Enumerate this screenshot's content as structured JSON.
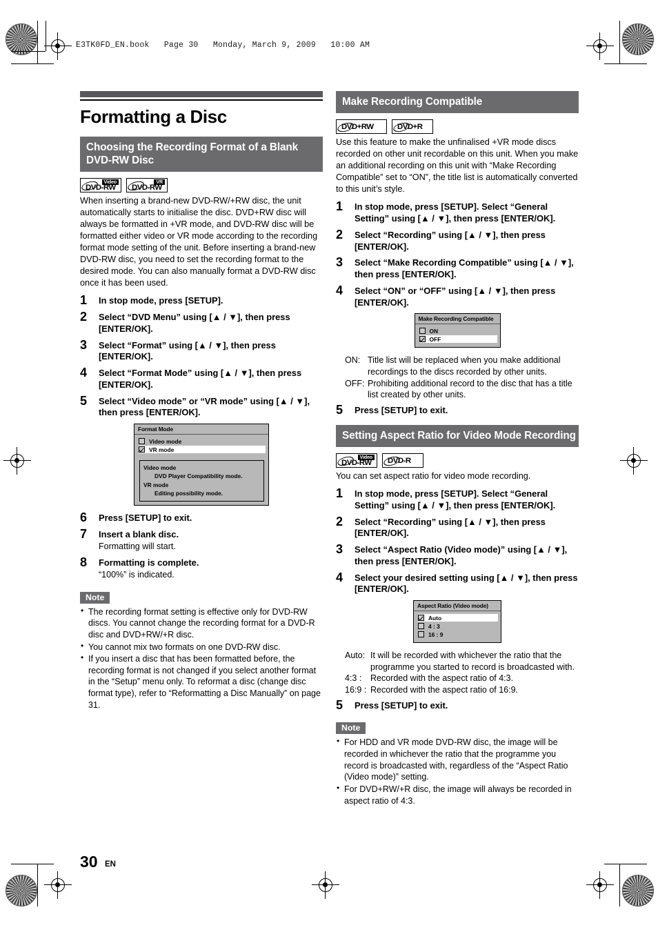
{
  "page": {
    "file_header": "E3TK0FD_EN.book   Page 30   Monday, March 9, 2009   10:00 AM",
    "number": "30",
    "language": "EN"
  },
  "chapter": {
    "title": "Formatting a Disc"
  },
  "sections": {
    "choosing_format": {
      "heading": "Choosing the Recording Format of a Blank DVD-RW Disc",
      "logos": [
        {
          "name": "DVD-RW",
          "kind": "Video",
          "kind_style": "inverse"
        },
        {
          "name": "DVD-RW",
          "kind": "VR",
          "kind_style": "inverse"
        }
      ],
      "intro": "When inserting a brand-new DVD-RW/+RW disc, the unit automatically starts to initialise the disc. DVD+RW disc will always be formatted in +VR mode, and DVD-RW disc will be formatted either video or VR mode according to the recording format mode setting of the unit. Before inserting a brand-new DVD-RW disc, you need to set the recording format to the desired mode. You can also manually format a DVD-RW disc once it has been used.",
      "steps": [
        {
          "num": "1",
          "text": "In stop mode, press [SETUP]."
        },
        {
          "num": "2",
          "text": "Select “DVD Menu” using [▲ / ▼], then press [ENTER/OK]."
        },
        {
          "num": "3",
          "text": "Select “Format” using [▲ / ▼], then press [ENTER/OK]."
        },
        {
          "num": "4",
          "text": "Select “Format Mode” using [▲ / ▼], then press [ENTER/OK]."
        },
        {
          "num": "5",
          "text": "Select “Video mode” or “VR mode” using [▲ / ▼], then press [ENTER/OK]."
        }
      ],
      "osd": {
        "title": "Format Mode",
        "options": [
          {
            "label": "Video mode",
            "checked": false,
            "highlighted": false
          },
          {
            "label": "VR mode",
            "checked": true,
            "highlighted": true
          }
        ],
        "help": [
          {
            "term": "Video mode",
            "desc": "DVD Player Compatibility mode."
          },
          {
            "term": "VR mode",
            "desc": "Editing possibility mode."
          }
        ]
      },
      "steps_after": [
        {
          "num": "6",
          "text": "Press [SETUP] to exit.",
          "sub": ""
        },
        {
          "num": "7",
          "text": "Insert a blank disc.",
          "sub": "Formatting will start."
        },
        {
          "num": "8",
          "text": "Formatting is complete.",
          "sub": "“100%” is indicated."
        }
      ],
      "note_label": "Note",
      "notes": [
        "The recording format setting is effective only for DVD-RW discs. You cannot change the recording format for a DVD-R disc and DVD+RW/+R disc.",
        "You cannot mix two formats on one DVD-RW disc.",
        "If you insert a disc that has been formatted before, the recording format is not changed if you select another format in the “Setup” menu only. To reformat a disc (change disc format type), refer to “Reformatting a Disc Manually” on page 31."
      ]
    },
    "make_recording_compatible": {
      "heading": "Make Recording Compatible",
      "logos": [
        {
          "name": "DVD+RW",
          "kind": "",
          "kind_style": "none"
        },
        {
          "name": "DVD+R",
          "kind": "",
          "kind_style": "none"
        }
      ],
      "intro": "Use this feature to make the unfinalised +VR mode discs recorded on other unit recordable on this unit. When you make an additional recording on this unit with “Make Recording Compatible” set to “ON”, the title list is automatically converted to this unit’s style.",
      "steps": [
        {
          "num": "1",
          "text": "In stop mode, press [SETUP]. Select “General Setting” using [▲ / ▼], then press [ENTER/OK]."
        },
        {
          "num": "2",
          "text": "Select “Recording” using [▲ / ▼], then press [ENTER/OK]."
        },
        {
          "num": "3",
          "text": "Select “Make Recording Compatible” using [▲ / ▼], then press [ENTER/OK]."
        },
        {
          "num": "4",
          "text": "Select “ON” or “OFF” using [▲ / ▼], then press [ENTER/OK]."
        }
      ],
      "osd": {
        "title": "Make Recording Compatible",
        "options": [
          {
            "label": "ON",
            "checked": false,
            "highlighted": false
          },
          {
            "label": "OFF",
            "checked": true,
            "highlighted": true
          }
        ]
      },
      "definitions": [
        {
          "term": "ON:",
          "desc": "Title list will be replaced when you make additional recordings to the discs recorded by other units."
        },
        {
          "term": "OFF:",
          "desc": "Prohibiting additional record to the disc that has a title list created by other units."
        }
      ],
      "steps_after": [
        {
          "num": "5",
          "text": "Press [SETUP] to exit."
        }
      ]
    },
    "aspect_ratio": {
      "heading": "Setting Aspect Ratio for Video Mode Recording",
      "logos": [
        {
          "name": "DVD-RW",
          "kind": "Video",
          "kind_style": "inverse"
        },
        {
          "name": "DVD-R",
          "kind": "",
          "kind_style": "none"
        }
      ],
      "intro": "You can set aspect ratio for video mode recording.",
      "steps": [
        {
          "num": "1",
          "text": "In stop mode, press [SETUP]. Select “General Setting” using [▲ / ▼], then press [ENTER/OK]."
        },
        {
          "num": "2",
          "text": "Select “Recording” using [▲ / ▼], then press [ENTER/OK]."
        },
        {
          "num": "3",
          "text": "Select “Aspect Ratio (Video mode)” using [▲ / ▼], then press [ENTER/OK]."
        },
        {
          "num": "4",
          "text": "Select your desired setting using [▲ / ▼], then press [ENTER/OK]."
        }
      ],
      "osd": {
        "title": "Aspect Ratio (Video mode)",
        "options": [
          {
            "label": "Auto",
            "checked": true,
            "highlighted": true
          },
          {
            "label": "4 : 3",
            "checked": false,
            "highlighted": false
          },
          {
            "label": "16 : 9",
            "checked": false,
            "highlighted": false
          }
        ]
      },
      "definitions": [
        {
          "term": "Auto:",
          "desc": "It will be recorded with whichever the ratio that the programme you started to record is broadcasted with."
        },
        {
          "term": "4:3 :",
          "desc": "Recorded with the aspect ratio of 4:3."
        },
        {
          "term": "16:9 :",
          "desc": "Recorded with the aspect ratio of 16:9."
        }
      ],
      "steps_after": [
        {
          "num": "5",
          "text": "Press [SETUP] to exit."
        }
      ],
      "note_label": "Note",
      "notes": [
        "For HDD and VR mode DVD-RW disc, the image will be recorded in whichever the ratio that the programme you record is broadcasted with, regardless of the “Aspect Ratio (Video mode)” setting.",
        "For DVD+RW/+R disc, the image will always be recorded in aspect ratio of 4:3."
      ]
    }
  }
}
